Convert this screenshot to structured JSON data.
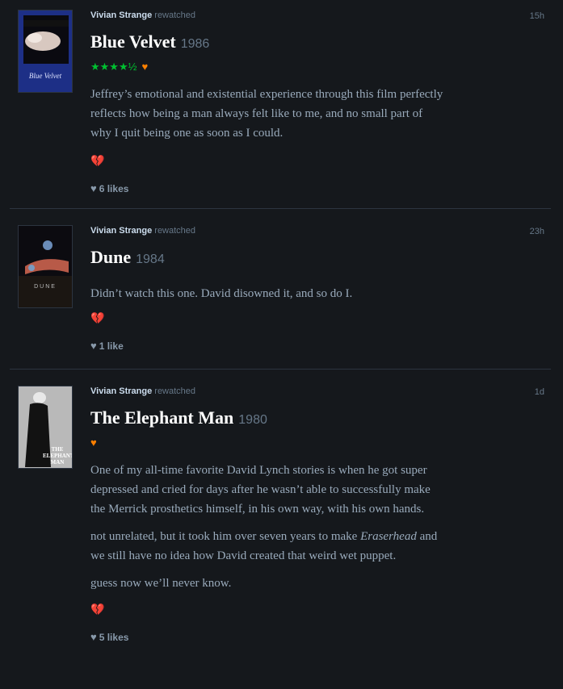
{
  "reviews": [
    {
      "user": "Vivian Strange",
      "action": "rewatched",
      "time": "15h",
      "title": "Blue Velvet",
      "year": "1986",
      "rating": "★★★★½",
      "liked": true,
      "paragraphs": [
        "Jeffrey’s emotional and existential experience through this film perfectly reflects how being a man always felt like to me, and no small part of why I quit being one as soon as I could."
      ],
      "likes": "6 likes",
      "poster_text": "Blue Velvet"
    },
    {
      "user": "Vivian Strange",
      "action": "rewatched",
      "time": "23h",
      "title": "Dune",
      "year": "1984",
      "paragraphs": [
        "Didn’t watch this one. David disowned it, and so do I."
      ],
      "likes": "1 like",
      "poster_text": "DUNE"
    },
    {
      "user": "Vivian Strange",
      "action": "rewatched",
      "time": "1d",
      "title": "The Elephant Man",
      "year": "1980",
      "liked": true,
      "paragraphs": [
        "One of my all-time favorite David Lynch stories is when he got super depressed and cried for days after he wasn’t able to successfully make the Merrick prosthetics himself, in his own way, with his own hands.",
        "not unrelated, but it took him over seven years to make",
        "guess now we’ll never know."
      ],
      "italic_title": "Eraserhead",
      "para2_tail": " and we still have no idea how David created that weird wet puppet.",
      "likes": "5 likes",
      "poster_text": "THE ELEPHANT MAN"
    }
  ],
  "colors": {
    "star": "#00c030",
    "heart": "#ff8000",
    "broken_heart": "#e0203a",
    "bg": "#15181c"
  },
  "icons": {
    "liked": "heart-icon",
    "broken": "broken-heart-icon",
    "likes": "like-heart-icon"
  }
}
